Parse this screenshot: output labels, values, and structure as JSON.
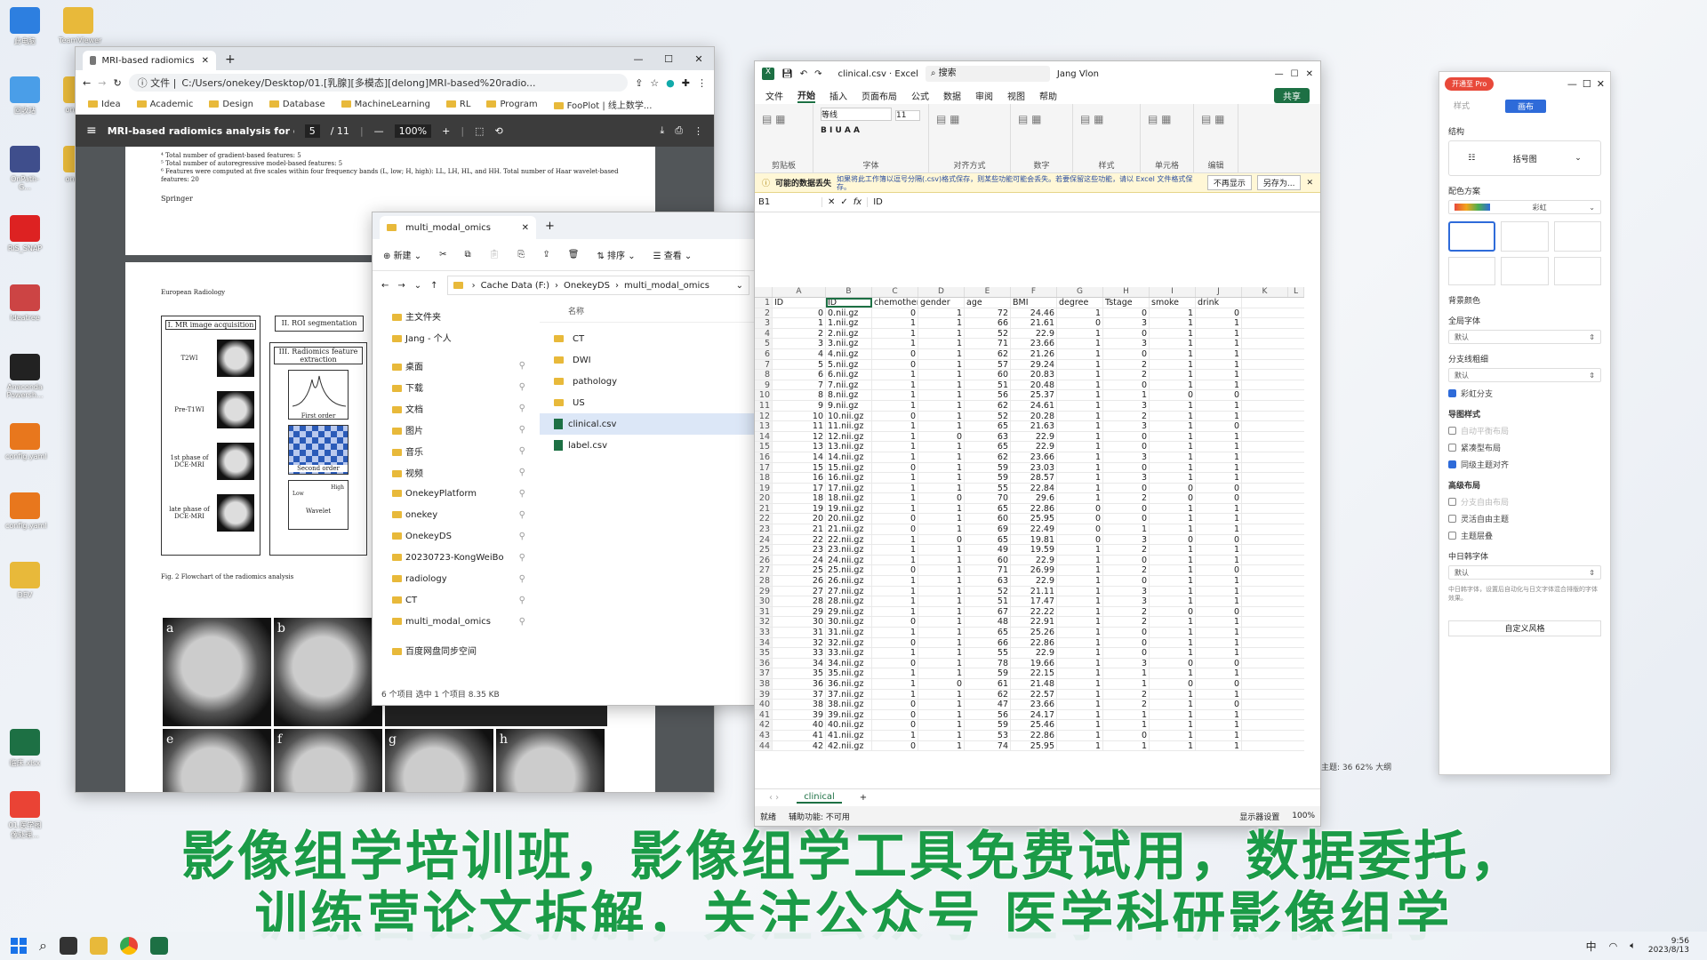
{
  "desktop": {
    "icons": [
      "此电脑",
      "TeamViewer",
      "回收站",
      "onekey",
      "OnPath-G...",
      "onekey",
      "RiS_SNAP",
      "Ideatree",
      "Anaconda Powersh...",
      "config.yaml",
      "config.yaml",
      "DEV",
      "临床.xlsx",
      "01.医学图像处理..."
    ]
  },
  "chrome": {
    "tab_title": "MRI-based radiomics analysi",
    "url": "C:/Users/onekey/Desktop/01.[乳腺][多模态][delong]MRI-based%20radio...",
    "bookmarks": [
      "Idea",
      "Academic",
      "Design",
      "Database",
      "MachineLearning",
      "RL",
      "Program",
      "FooPlot | 线上数学..."
    ],
    "pdf": {
      "title": "MRI-based radiomics analysis for diff...",
      "page": "5",
      "total": "/ 11",
      "zoom": "100%"
    },
    "page1": {
      "notes": [
        "⁴ Total number of gradient-based features: 5",
        "⁵ Total number of autoregressive model-based features: 5",
        "⁶ Features were computed at five scales within four frequency bands (L, low; H, high): LL, LH, HL, and HH. Total number of Haar wavelet-based features: 20"
      ],
      "publisher": "Springer"
    },
    "page2": {
      "header": "European Radiology",
      "box1": "I. MR image acquisition",
      "box2": "II. ROI segmentation",
      "box3": "III. Radiomics feature extraction",
      "seq": [
        "T2WI",
        "Pre-T1WI",
        "1st phase of DCE-MRI",
        "late phase of DCE-MRI"
      ],
      "feat": [
        "First order",
        "Second order",
        "Wavelet"
      ],
      "wave": [
        "High",
        "Low"
      ],
      "caption": "Fig. 2  Flowchart of the radiomics analysis",
      "panels": [
        "a",
        "b",
        "e",
        "f",
        "g",
        "h"
      ]
    }
  },
  "explorer": {
    "tab": "multi_modal_omics",
    "new": "新建",
    "sort": "排序",
    "view": "查看",
    "breadcrumb": [
      "Cache Data (F:)",
      "OnekeyDS",
      "multi_modal_omics"
    ],
    "sidebar": [
      "主文件夹",
      "Jang - 个人",
      "桌面",
      "下载",
      "文档",
      "图片",
      "音乐",
      "视频",
      "OnekeyPlatform",
      "onekey",
      "OnekeyDS",
      "20230723-KongWeiBo",
      "radiology",
      "CT",
      "multi_modal_omics",
      "百度网盘同步空间"
    ],
    "header": "名称",
    "files": [
      {
        "n": "CT",
        "t": "folder"
      },
      {
        "n": "DWI",
        "t": "folder"
      },
      {
        "n": "pathology",
        "t": "folder"
      },
      {
        "n": "US",
        "t": "folder"
      },
      {
        "n": "clinical.csv",
        "t": "csv"
      },
      {
        "n": "label.csv",
        "t": "csv"
      }
    ],
    "status": "6 个项目    选中 1 个项目  8.35 KB"
  },
  "excel": {
    "file": "clinical.csv · Excel",
    "search": "搜索",
    "user": "Jang Vlon",
    "share": "共享",
    "menu": [
      "文件",
      "开始",
      "插入",
      "页面布局",
      "公式",
      "数据",
      "审阅",
      "视图",
      "帮助"
    ],
    "groups": [
      "剪贴板",
      "字体",
      "对齐方式",
      "数字",
      "样式",
      "单元格",
      "编辑"
    ],
    "font": "等线",
    "size": "11",
    "warn_title": "可能的数据丢失",
    "warn_text": "如果将此工作簿以逗号分隔(.csv)格式保存，则某些功能可能会丢失。若要保留这些功能，请以 Excel 文件格式保存。",
    "warn_btn1": "不再显示",
    "warn_btn2": "另存为...",
    "cell": "B1",
    "formula": "ID",
    "cols": [
      "A",
      "B",
      "C",
      "D",
      "E",
      "F",
      "G",
      "H",
      "I",
      "J",
      "K",
      "L"
    ],
    "headers": [
      "ID",
      "ID",
      "chemother",
      "gender",
      "age",
      "BMI",
      "degree",
      "Tstage",
      "smoke",
      "drink"
    ],
    "rows": [
      [
        0,
        "0.nii.gz",
        0,
        1,
        72,
        24.46,
        1,
        0,
        1,
        0
      ],
      [
        1,
        "1.nii.gz",
        1,
        1,
        66,
        21.61,
        0,
        3,
        1,
        1
      ],
      [
        2,
        "2.nii.gz",
        1,
        1,
        52,
        22.9,
        1,
        0,
        1,
        1
      ],
      [
        3,
        "3.nii.gz",
        1,
        1,
        71,
        23.66,
        1,
        3,
        1,
        1
      ],
      [
        4,
        "4.nii.gz",
        0,
        1,
        62,
        21.26,
        1,
        0,
        1,
        1
      ],
      [
        5,
        "5.nii.gz",
        0,
        1,
        57,
        29.24,
        1,
        2,
        1,
        1
      ],
      [
        6,
        "6.nii.gz",
        1,
        1,
        60,
        20.83,
        1,
        2,
        1,
        1
      ],
      [
        7,
        "7.nii.gz",
        1,
        1,
        51,
        20.48,
        1,
        0,
        1,
        1
      ],
      [
        8,
        "8.nii.gz",
        1,
        1,
        56,
        25.37,
        1,
        1,
        0,
        0
      ],
      [
        9,
        "9.nii.gz",
        1,
        1,
        62,
        24.61,
        1,
        3,
        1,
        1
      ],
      [
        10,
        "10.nii.gz",
        0,
        1,
        52,
        20.28,
        1,
        2,
        1,
        1
      ],
      [
        11,
        "11.nii.gz",
        1,
        1,
        65,
        21.63,
        1,
        3,
        1,
        0
      ],
      [
        12,
        "12.nii.gz",
        1,
        0,
        63,
        22.9,
        1,
        0,
        1,
        1
      ],
      [
        13,
        "13.nii.gz",
        1,
        1,
        65,
        22.9,
        1,
        0,
        1,
        1
      ],
      [
        14,
        "14.nii.gz",
        1,
        1,
        62,
        23.66,
        1,
        3,
        1,
        1
      ],
      [
        15,
        "15.nii.gz",
        0,
        1,
        59,
        23.03,
        1,
        0,
        1,
        1
      ],
      [
        16,
        "16.nii.gz",
        1,
        1,
        59,
        28.57,
        1,
        3,
        1,
        1
      ],
      [
        17,
        "17.nii.gz",
        1,
        1,
        55,
        22.84,
        1,
        0,
        0,
        0
      ],
      [
        18,
        "18.nii.gz",
        1,
        0,
        70,
        29.6,
        1,
        2,
        0,
        0
      ],
      [
        19,
        "19.nii.gz",
        1,
        1,
        65,
        22.86,
        0,
        0,
        1,
        1
      ],
      [
        20,
        "20.nii.gz",
        0,
        1,
        60,
        25.95,
        0,
        0,
        1,
        1
      ],
      [
        21,
        "21.nii.gz",
        0,
        1,
        69,
        22.49,
        0,
        1,
        1,
        1
      ],
      [
        22,
        "22.nii.gz",
        1,
        0,
        65,
        19.81,
        0,
        3,
        0,
        0
      ],
      [
        23,
        "23.nii.gz",
        1,
        1,
        49,
        19.59,
        1,
        2,
        1,
        1
      ],
      [
        24,
        "24.nii.gz",
        1,
        1,
        60,
        22.9,
        1,
        0,
        1,
        1
      ],
      [
        25,
        "25.nii.gz",
        0,
        1,
        71,
        26.99,
        1,
        2,
        1,
        0
      ],
      [
        26,
        "26.nii.gz",
        1,
        1,
        63,
        22.9,
        1,
        0,
        1,
        1
      ],
      [
        27,
        "27.nii.gz",
        1,
        1,
        52,
        21.11,
        1,
        3,
        1,
        1
      ],
      [
        28,
        "28.nii.gz",
        1,
        1,
        51,
        17.47,
        1,
        3,
        1,
        1
      ],
      [
        29,
        "29.nii.gz",
        1,
        1,
        67,
        22.22,
        1,
        2,
        0,
        0
      ],
      [
        30,
        "30.nii.gz",
        0,
        1,
        48,
        22.91,
        1,
        2,
        1,
        1
      ],
      [
        31,
        "31.nii.gz",
        1,
        1,
        65,
        25.26,
        1,
        0,
        1,
        1
      ],
      [
        32,
        "32.nii.gz",
        0,
        1,
        66,
        22.86,
        1,
        0,
        1,
        1
      ],
      [
        33,
        "33.nii.gz",
        1,
        1,
        55,
        22.9,
        1,
        0,
        1,
        1
      ],
      [
        34,
        "34.nii.gz",
        0,
        1,
        78,
        19.66,
        1,
        3,
        0,
        0
      ],
      [
        35,
        "35.nii.gz",
        1,
        1,
        59,
        22.15,
        1,
        1,
        1,
        1
      ],
      [
        36,
        "36.nii.gz",
        1,
        0,
        61,
        21.48,
        1,
        1,
        0,
        0
      ],
      [
        37,
        "37.nii.gz",
        1,
        1,
        62,
        22.57,
        1,
        2,
        1,
        1
      ],
      [
        38,
        "38.nii.gz",
        0,
        1,
        47,
        23.66,
        1,
        2,
        1,
        0
      ],
      [
        39,
        "39.nii.gz",
        0,
        1,
        56,
        24.17,
        1,
        1,
        1,
        1
      ],
      [
        40,
        "40.nii.gz",
        0,
        1,
        59,
        25.46,
        1,
        1,
        1,
        1
      ],
      [
        41,
        "41.nii.gz",
        1,
        1,
        53,
        22.86,
        1,
        0,
        1,
        1
      ],
      [
        42,
        "42.nii.gz",
        0,
        1,
        74,
        25.95,
        1,
        1,
        1,
        1
      ]
    ],
    "sheet": "clinical",
    "status_ready": "就绪",
    "status_access": "辅助功能: 不可用",
    "status_display": "显示器设置",
    "zoom": "100%"
  },
  "mind": {
    "badge": "开通至 Pro",
    "tabs": [
      "样式",
      "画布"
    ],
    "struct_label": "结构",
    "struct": "括号图",
    "scheme_label": "配色方案",
    "scheme": "彩虹",
    "bg_label": "背景颜色",
    "font_label": "全局字体",
    "font": "默认",
    "branch_label": "分支线粗细",
    "branch": "默认",
    "rainbow": "彩虹分支",
    "layout_label": "导图样式",
    "layout_opts": [
      "自动平衡布局",
      "紧凑型布局",
      "同级主题对齐"
    ],
    "adv_label": "高级布局",
    "adv_opts": [
      "分支自由布局",
      "灵活自由主题",
      "主题层叠"
    ],
    "cjk_label": "中日韩字体",
    "cjk": "默认",
    "cjk_note": "中日韩字体，设置后自动化与日文字体混合排版的字体效果。",
    "custom": "自定义风格",
    "bottom": "主题: 36   62%   大纲"
  },
  "banner": {
    "line1": "影像组学培训班，影像组学工具免费试用，数据委托，",
    "line2": "训练营论文拆解，关注公众号 医学科研影像组学"
  },
  "taskbar": {
    "time": "9:56",
    "date": "2023/8/13",
    "ime": "中"
  }
}
